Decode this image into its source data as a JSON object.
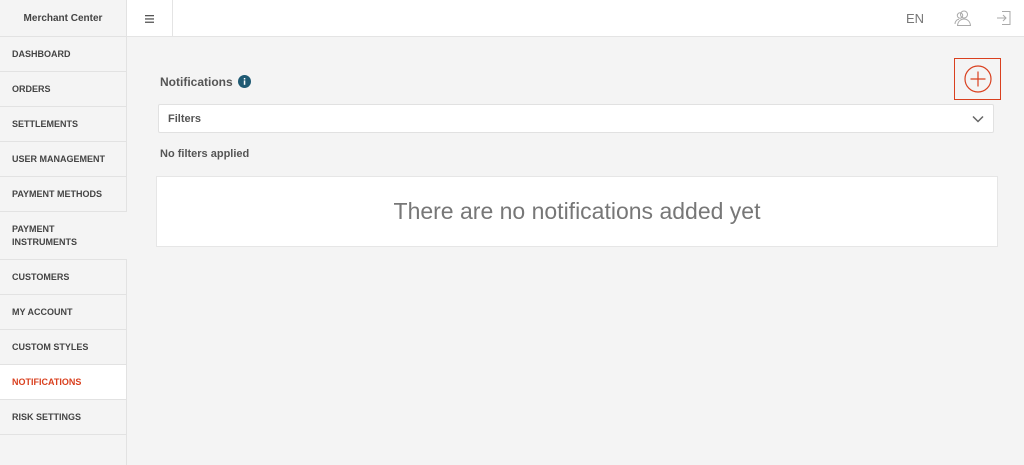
{
  "app": {
    "title": "Merchant Center"
  },
  "sidebar": {
    "items": [
      {
        "label": "DASHBOARD",
        "active": false
      },
      {
        "label": "ORDERS",
        "active": false
      },
      {
        "label": "SETTLEMENTS",
        "active": false
      },
      {
        "label": "USER MANAGEMENT",
        "active": false
      },
      {
        "label": "PAYMENT METHODS",
        "active": false
      },
      {
        "label": "PAYMENT INSTRUMENTS",
        "active": false
      },
      {
        "label": "CUSTOMERS",
        "active": false
      },
      {
        "label": "MY ACCOUNT",
        "active": false
      },
      {
        "label": "CUSTOM STYLES",
        "active": false
      },
      {
        "label": "NOTIFICATIONS",
        "active": true
      },
      {
        "label": "RISK SETTINGS",
        "active": false
      }
    ]
  },
  "topbar": {
    "menu_icon": "hamburger-icon",
    "language": "EN",
    "user_icon": "user-icon",
    "logout_icon": "logout-icon"
  },
  "main": {
    "title": "Notifications",
    "info_icon": "info-icon",
    "add_icon": "add-circle-icon",
    "filters_label": "Filters",
    "filters_status": "No filters applied",
    "empty_message": "There are no notifications added yet"
  },
  "colors": {
    "accent": "#d9401f",
    "info": "#1f5a73",
    "background": "#f4f4f4"
  }
}
